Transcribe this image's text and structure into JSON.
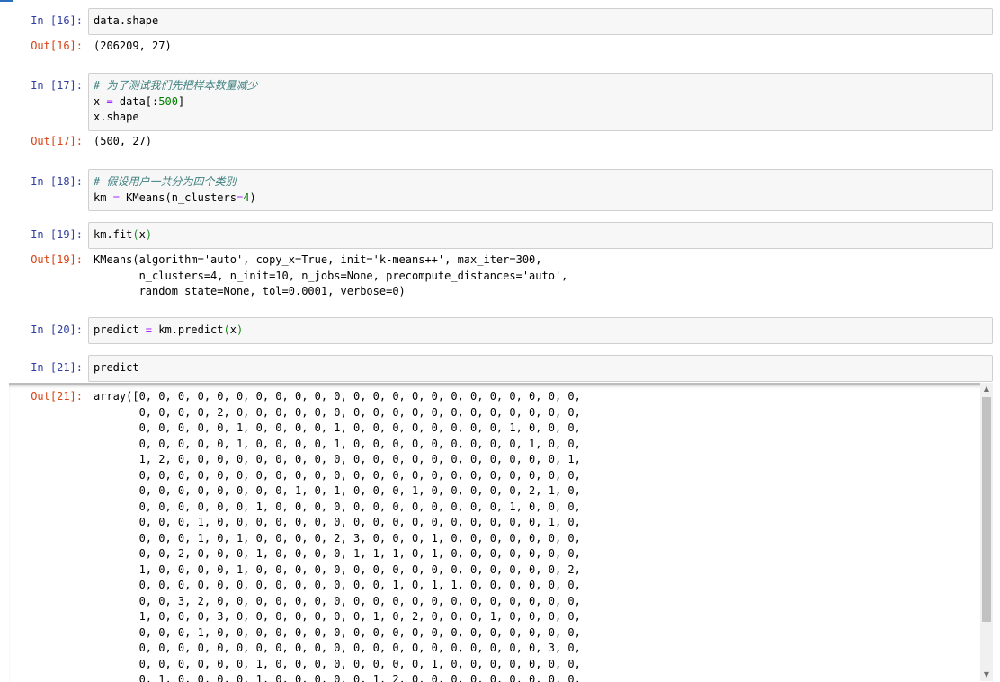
{
  "cells": [
    {
      "in_prompt": "In  [16]:",
      "code": [
        [
          {
            "t": "data.shape",
            "c": ""
          }
        ]
      ],
      "out_prompt": "Out[16]:",
      "output": [
        "(206209, 27)"
      ]
    },
    {
      "in_prompt": "In  [17]:",
      "code": [
        [
          {
            "t": "# 为了测试我们先把样本数量减少",
            "c": "comment"
          }
        ],
        [
          {
            "t": "x ",
            "c": ""
          },
          {
            "t": "=",
            "c": "op"
          },
          {
            "t": " data[:",
            "c": ""
          },
          {
            "t": "500",
            "c": "num"
          },
          {
            "t": "]",
            "c": ""
          }
        ],
        [
          {
            "t": "x.shape",
            "c": ""
          }
        ]
      ],
      "out_prompt": "Out[17]:",
      "output": [
        "(500, 27)"
      ]
    },
    {
      "in_prompt": "In  [18]:",
      "code": [
        [
          {
            "t": "# 假设用户一共分为四个类别",
            "c": "comment"
          }
        ],
        [
          {
            "t": "km ",
            "c": ""
          },
          {
            "t": "=",
            "c": "op"
          },
          {
            "t": " KMeans(n_clusters",
            "c": ""
          },
          {
            "t": "=",
            "c": "op"
          },
          {
            "t": "4",
            "c": "num"
          },
          {
            "t": ")",
            "c": ""
          }
        ]
      ]
    },
    {
      "in_prompt": "In  [19]:",
      "code": [
        [
          {
            "t": "km.fit",
            "c": ""
          },
          {
            "t": "(",
            "c": "bracket"
          },
          {
            "t": "x",
            "c": ""
          },
          {
            "t": ")",
            "c": "bracket"
          }
        ]
      ],
      "out_prompt": "Out[19]:",
      "output": [
        "KMeans(algorithm='auto', copy_x=True, init='k-means++', max_iter=300,",
        "       n_clusters=4, n_init=10, n_jobs=None, precompute_distances='auto',",
        "       random_state=None, tol=0.0001, verbose=0)"
      ]
    },
    {
      "in_prompt": "In  [20]:",
      "code": [
        [
          {
            "t": "predict ",
            "c": ""
          },
          {
            "t": "=",
            "c": "op"
          },
          {
            "t": " km.predict",
            "c": ""
          },
          {
            "t": "(",
            "c": "bracket"
          },
          {
            "t": "x",
            "c": ""
          },
          {
            "t": ")",
            "c": "bracket"
          }
        ]
      ]
    },
    {
      "in_prompt": "In  [21]:",
      "code": [
        [
          {
            "t": "predict",
            "c": ""
          }
        ]
      ]
    }
  ],
  "scroll_output": {
    "out_prompt": "Out[21]:",
    "lines": [
      "array([0, 0, 0, 0, 0, 0, 0, 0, 0, 0, 0, 0, 0, 0, 0, 0, 0, 0, 0, 0, 0, 0, 0,",
      "       0, 0, 0, 0, 2, 0, 0, 0, 0, 0, 0, 0, 0, 0, 0, 0, 0, 0, 0, 0, 0, 0, 0,",
      "       0, 0, 0, 0, 0, 1, 0, 0, 0, 0, 1, 0, 0, 0, 0, 0, 0, 0, 0, 1, 0, 0, 0,",
      "       0, 0, 0, 0, 0, 1, 0, 0, 0, 0, 1, 0, 0, 0, 0, 0, 0, 0, 0, 0, 1, 0, 0,",
      "       1, 2, 0, 0, 0, 0, 0, 0, 0, 0, 0, 0, 0, 0, 0, 0, 0, 0, 0, 0, 0, 0, 1,",
      "       0, 0, 0, 0, 0, 0, 0, 0, 0, 0, 0, 0, 0, 0, 0, 0, 0, 0, 0, 0, 0, 0, 0,",
      "       0, 0, 0, 0, 0, 0, 0, 0, 1, 0, 1, 0, 0, 0, 1, 0, 0, 0, 0, 0, 2, 1, 0,",
      "       0, 0, 0, 0, 0, 0, 1, 0, 0, 0, 0, 0, 0, 0, 0, 0, 0, 0, 0, 1, 0, 0, 0,",
      "       0, 0, 0, 1, 0, 0, 0, 0, 0, 0, 0, 0, 0, 0, 0, 0, 0, 0, 0, 0, 0, 1, 0,",
      "       0, 0, 0, 1, 0, 1, 0, 0, 0, 0, 2, 3, 0, 0, 0, 1, 0, 0, 0, 0, 0, 0, 0,",
      "       0, 0, 2, 0, 0, 0, 1, 0, 0, 0, 0, 1, 1, 1, 0, 1, 0, 0, 0, 0, 0, 0, 0,",
      "       1, 0, 0, 0, 0, 1, 0, 0, 0, 0, 0, 0, 0, 0, 0, 0, 0, 0, 0, 0, 0, 0, 2,",
      "       0, 0, 0, 0, 0, 0, 0, 0, 0, 0, 0, 0, 0, 1, 0, 1, 1, 0, 0, 0, 0, 0, 0,",
      "       0, 0, 3, 2, 0, 0, 0, 0, 0, 0, 0, 0, 0, 0, 0, 0, 0, 0, 0, 0, 0, 0, 0,",
      "       1, 0, 0, 0, 3, 0, 0, 0, 0, 0, 0, 0, 1, 0, 2, 0, 0, 0, 1, 0, 0, 0, 0,",
      "       0, 0, 0, 1, 0, 0, 0, 0, 0, 0, 0, 0, 0, 0, 0, 0, 0, 0, 0, 0, 0, 0, 0,",
      "       0, 0, 0, 0, 0, 0, 0, 0, 0, 0, 0, 0, 0, 0, 0, 0, 0, 0, 0, 0, 0, 3, 0,",
      "       0, 0, 0, 0, 0, 0, 1, 0, 0, 0, 0, 0, 0, 0, 0, 1, 0, 0, 0, 0, 0, 0, 0,",
      "       0, 1, 0, 0, 0, 0, 1, 0, 0, 0, 0, 0, 1, 2, 0, 0, 0, 0, 0, 0, 0, 0, 0,"
    ]
  },
  "colors": {
    "prompt_in": "#303f9f",
    "prompt_out": "#d84315",
    "comment": "#408080",
    "operator": "#aa22ff",
    "number": "#008000",
    "input_bg": "#f7f7f7",
    "input_border": "#cfcfcf"
  },
  "icons": {
    "scroll_up": "triangle-up",
    "scroll_down": "triangle-down"
  }
}
